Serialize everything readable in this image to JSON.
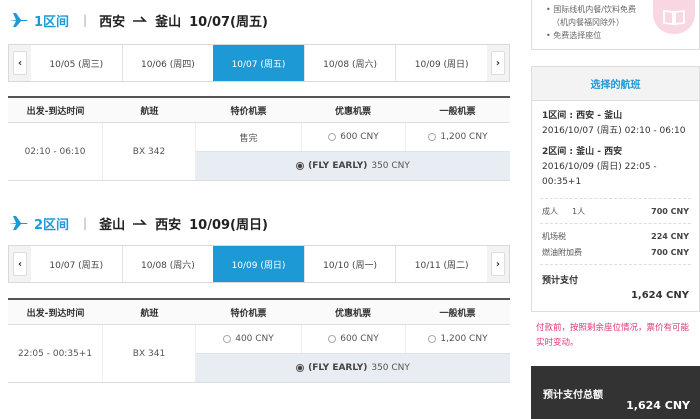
{
  "sidebar_top": {
    "bullets": [
      "国际线机内餐/饮料免费",
      "（机内餐福冈除外）",
      "免费选择座位"
    ]
  },
  "segments": [
    {
      "no": "1区间",
      "origin": "西安",
      "dest": "釜山",
      "date": "10/07(周五)",
      "dates": [
        {
          "label": "10/05 (周三)",
          "active": false
        },
        {
          "label": "10/06 (周四)",
          "active": false
        },
        {
          "label": "10/07 (周五)",
          "active": true
        },
        {
          "label": "10/08 (周六)",
          "active": false
        },
        {
          "label": "10/09 (周日)",
          "active": false
        }
      ],
      "headers": [
        "出发-到达时间",
        "航班",
        "特价机票",
        "优惠机票",
        "一般机票"
      ],
      "time": "02:10 - 06:10",
      "flight": "BX 342",
      "special": "售完",
      "special_radio": false,
      "discount": "600 CNY",
      "normal": "1,200 CNY",
      "flyearly_label": "(FLY EARLY)",
      "flyearly_price": "350 CNY"
    },
    {
      "no": "2区间",
      "origin": "釜山",
      "dest": "西安",
      "date": "10/09(周日)",
      "dates": [
        {
          "label": "10/07 (周五)",
          "active": false
        },
        {
          "label": "10/08 (周六)",
          "active": false
        },
        {
          "label": "10/09 (周日)",
          "active": true
        },
        {
          "label": "10/10 (周一)",
          "active": false
        },
        {
          "label": "10/11 (周二)",
          "active": false
        }
      ],
      "headers": [
        "出发-到达时间",
        "航班",
        "特价机票",
        "优惠机票",
        "一般机票"
      ],
      "time": "22:05 - 00:35+1",
      "flight": "BX 341",
      "special": "400 CNY",
      "special_radio": true,
      "discount": "600 CNY",
      "normal": "1,200 CNY",
      "flyearly_label": "(FLY EARLY)",
      "flyearly_price": "350 CNY"
    }
  ],
  "summary": {
    "title": "选择的航班",
    "leg1_head": "1区间 : 西安 - 釜山",
    "leg1_detail": "2016/10/07 (周五) 02:10 - 06:10",
    "leg2_head": "2区间 : 釜山 - 西安",
    "leg2_detail1": "2016/10/09 (周日) 22:05 -",
    "leg2_detail2": "00:35+1",
    "adult_label": "成人",
    "adult_count": "1人",
    "adult_amount": "700 CNY",
    "airport_tax_label": "机场税",
    "airport_tax": "224 CNY",
    "fuel_label": "燃油附加费",
    "fuel": "700 CNY",
    "estimate_label": "预计支付",
    "estimate_amount": "1,624 CNY",
    "notice": "付款前，按照剩余座位情况，票价有可能实时变动。",
    "total_label": "预计支付总额",
    "total_amount": "1,624 CNY"
  },
  "colors": {
    "accent": "#1d9ad6",
    "notice": "#e0357c",
    "total_bg": "#333333"
  },
  "icons": {
    "segment": "airplane-icon",
    "route": "one-way-arrow-icon",
    "prev": "chevron-left-icon",
    "next": "chevron-right-icon",
    "sidebar": "book-icon"
  }
}
